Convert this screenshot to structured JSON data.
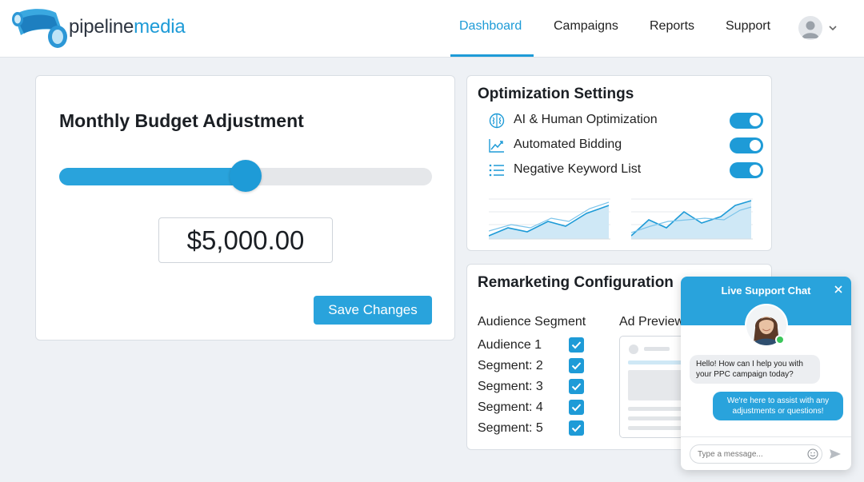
{
  "brand": {
    "part1": "pipeline",
    "part2": "media"
  },
  "nav": {
    "items": [
      {
        "label": "Dashboard",
        "active": true
      },
      {
        "label": "Campaigns",
        "active": false
      },
      {
        "label": "Reports",
        "active": false
      },
      {
        "label": "Support",
        "active": false
      }
    ]
  },
  "budget": {
    "title": "Monthly Budget Adjustment",
    "slider_fraction": 0.5,
    "amount": "$5,000.00",
    "save_label": "Save Changes"
  },
  "optimization": {
    "title": "Optimization Settings",
    "items": [
      {
        "label": "AI & Human Optimization",
        "icon": "brain-icon",
        "enabled": true
      },
      {
        "label": "Automated Bidding",
        "icon": "trend-chart-icon",
        "enabled": true
      },
      {
        "label": "Negative Keyword List",
        "icon": "list-icon",
        "enabled": true
      }
    ]
  },
  "remarketing": {
    "title": "Remarketing Configuration",
    "segment_header": "Audience Segment",
    "preview_header": "Ad Preview",
    "segments": [
      {
        "label": "Audience 1",
        "checked": true
      },
      {
        "label": "Segment: 2",
        "checked": true
      },
      {
        "label": "Segment: 3",
        "checked": true
      },
      {
        "label": "Segment: 4",
        "checked": true
      },
      {
        "label": "Segment: 5",
        "checked": true
      }
    ]
  },
  "chat": {
    "title": "Live Support Chat",
    "incoming": "Hello! How can I help you with your PPC campaign today?",
    "outgoing": "We're here to assist with any adjustments or questions!",
    "input_placeholder": "Type a message..."
  },
  "colors": {
    "accent": "#1e9bd7",
    "online": "#3cc65b"
  }
}
